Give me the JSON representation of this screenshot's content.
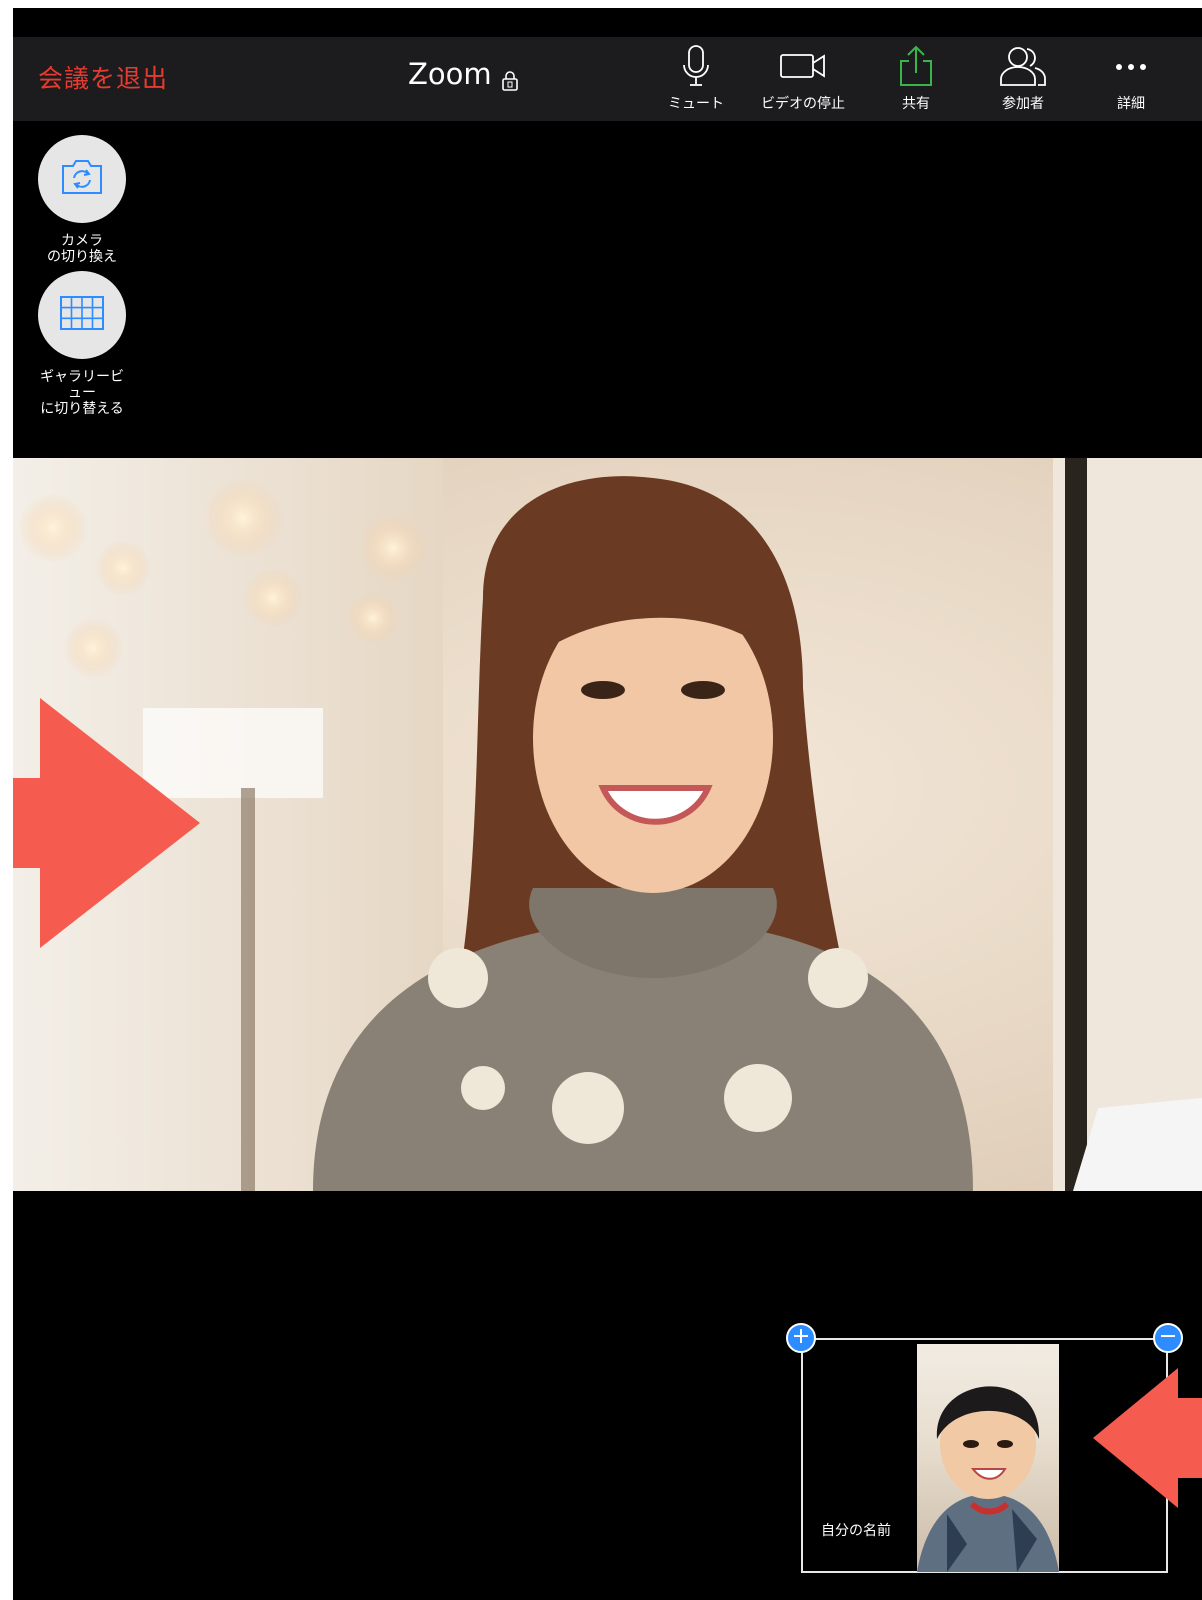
{
  "topbar": {
    "leave_label": "会議を退出",
    "title": "Zoom",
    "buttons": {
      "mute": "ミュート",
      "stop_video": "ビデオの停止",
      "share": "共有",
      "participants": "参加者",
      "more": "詳細"
    }
  },
  "side": {
    "switch_camera": "カメラ\nの切り換え",
    "gallery_view": "ギャラリービ\nュー\nに切り替える"
  },
  "self_view": {
    "name": "自分の名前"
  },
  "colors": {
    "leave": "#e63b2e",
    "share_icon": "#39b54a",
    "accent": "#2d8cff",
    "arrow": "#f55b4e"
  },
  "icons": [
    "lock-icon",
    "microphone-icon",
    "video-camera-icon",
    "share-icon",
    "participants-icon",
    "more-icon",
    "switch-camera-icon",
    "gallery-grid-icon",
    "plus-icon",
    "minus-icon"
  ]
}
